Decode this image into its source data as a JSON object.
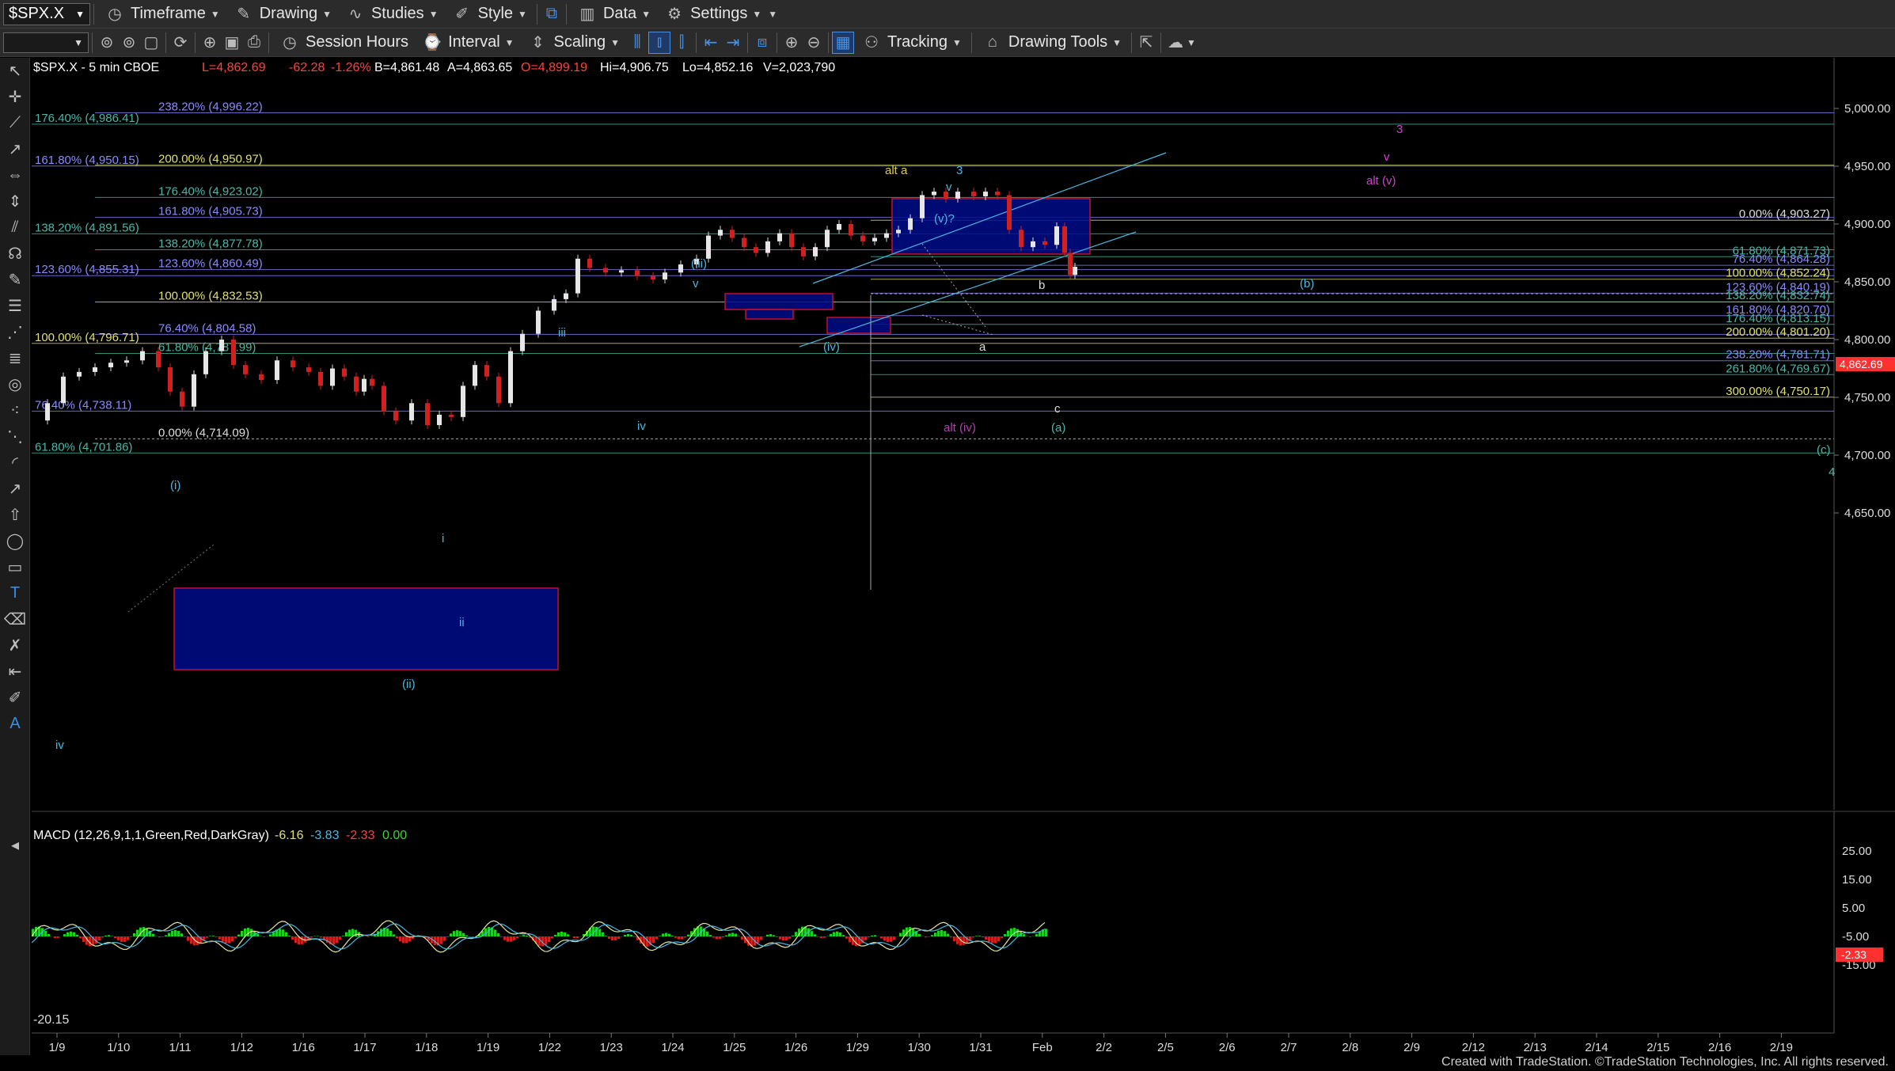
{
  "toolbar1": {
    "symbol": "$SPX.X",
    "timeframe": "Timeframe",
    "drawing": "Drawing",
    "studies": "Studies",
    "style": "Style",
    "data": "Data",
    "settings": "Settings"
  },
  "toolbar2": {
    "session_hours": "Session Hours",
    "interval": "Interval",
    "scaling": "Scaling",
    "tracking": "Tracking",
    "drawing_tools": "Drawing Tools"
  },
  "header": {
    "symbol_info": "$SPX.X - 5 min  CBOE",
    "last": "L=4,862.69",
    "net": "-62.28",
    "pct": "-1.26%",
    "bid": "B=4,861.48",
    "ask": "A=4,863.65",
    "open": "O=4,899.19",
    "hi": "Hi=4,906.75",
    "lo": "Lo=4,852.16",
    "vol": "V=2,023,790"
  },
  "price_axis": [
    "5,000.00",
    "4,950.00",
    "4,900.00",
    "4,850.00",
    "4,800.00",
    "4,750.00",
    "4,700.00",
    "4,650.00"
  ],
  "last_price_tag": "4,862.69",
  "macd": {
    "label": "MACD (12,26,9,1,1,Green,Red,DarkGray)",
    "v1": "-6.16",
    "v2": "-3.83",
    "v3": "-2.33",
    "v4": "0.00",
    "min_label": "-20.15",
    "axis": [
      "25.00",
      "15.00",
      "5.00",
      "-5.00",
      "-15.00"
    ],
    "tag": "-2.33"
  },
  "date_axis": [
    "1/9",
    "1/10",
    "1/11",
    "1/12",
    "1/16",
    "1/17",
    "1/18",
    "1/19",
    "1/22",
    "1/23",
    "1/24",
    "1/25",
    "1/26",
    "1/29",
    "1/30",
    "1/31",
    "Feb",
    "2/2",
    "2/5",
    "2/6",
    "2/7",
    "2/8",
    "2/9",
    "2/12",
    "2/13",
    "2/14",
    "2/15",
    "2/16",
    "2/19"
  ],
  "fib_left": [
    {
      "text": "238.20% (4,996.22)",
      "color": "#8a8aff"
    },
    {
      "text": "176.40% (4,986.41)",
      "color": "#49b8a8"
    },
    {
      "text": "161.80% (4,950.15)",
      "color": "#8a8aff"
    },
    {
      "text": "200.00% (4,950.97)",
      "color": "#e0e070"
    },
    {
      "text": "176.40% (4,923.02)",
      "color": "#49b8a8"
    },
    {
      "text": "161.80% (4,905.73)",
      "color": "#8a8aff"
    },
    {
      "text": "138.20% (4,891.56)",
      "color": "#49b8a8"
    },
    {
      "text": "138.20% (4,877.78)",
      "color": "#49b8a8"
    },
    {
      "text": "123.60% (4,860.49)",
      "color": "#8a8aff"
    },
    {
      "text": "123.60% (4,855.31)",
      "color": "#8a8aff"
    },
    {
      "text": "100.00% (4,832.53)",
      "color": "#e0e070"
    },
    {
      "text": "76.40% (4,804.58)",
      "color": "#8a8aff"
    },
    {
      "text": "100.00% (4,796.71)",
      "color": "#e0e070"
    },
    {
      "text": "61.80% (4,787.99)",
      "color": "#49b8a8"
    },
    {
      "text": "76.40% (4,738.11)",
      "color": "#8a8aff"
    },
    {
      "text": "0.00% (4,714.09)",
      "color": "#dddddd"
    },
    {
      "text": "61.80% (4,701.86)",
      "color": "#49b8a8"
    }
  ],
  "fib_right": [
    {
      "text": "0.00% (4,903.27)",
      "color": "#dddddd"
    },
    {
      "text": "61.80% (4,871.73)",
      "color": "#49b8a8"
    },
    {
      "text": "76.40% (4,864.28)",
      "color": "#8a8aff"
    },
    {
      "text": "100.00% (4,852.24)",
      "color": "#e0e070"
    },
    {
      "text": "123.60% (4,840.19)",
      "color": "#8a8aff"
    },
    {
      "text": "138.20% (4,832.74)",
      "color": "#49b8a8"
    },
    {
      "text": "161.80% (4,820.70)",
      "color": "#8a8aff"
    },
    {
      "text": "176.40% (4,813.15)",
      "color": "#49b8a8"
    },
    {
      "text": "200.00% (4,801.20)",
      "color": "#e0e070"
    },
    {
      "text": "238.20% (4,781.71)",
      "color": "#8a8aff"
    },
    {
      "text": "261.80% (4,769.67)",
      "color": "#49b8a8"
    },
    {
      "text": "300.00% (4,750.17)",
      "color": "#e0e070"
    }
  ],
  "wave_labels": [
    {
      "text": "alt a",
      "color": "#e0d030"
    },
    {
      "text": "3",
      "color": "#49b8e0"
    },
    {
      "text": "v",
      "color": "#49b8e0"
    },
    {
      "text": "(v)?",
      "color": "#49b8e0"
    },
    {
      "text": "(iii)",
      "color": "#49b8e0"
    },
    {
      "text": "v",
      "color": "#49b8e0"
    },
    {
      "text": "iii",
      "color": "#49b8e0"
    },
    {
      "text": "iv",
      "color": "#49b8e0"
    },
    {
      "text": "(iv)",
      "color": "#49b8e0"
    },
    {
      "text": "a",
      "color": "#dddddd"
    },
    {
      "text": "b",
      "color": "#dddddd"
    },
    {
      "text": "c",
      "color": "#dddddd"
    },
    {
      "text": "(a)",
      "color": "#49b8a8"
    },
    {
      "text": "(b)",
      "color": "#49b8e0"
    },
    {
      "text": "alt (iv)",
      "color": "#b040b0"
    },
    {
      "text": "3",
      "color": "#d040d0"
    },
    {
      "text": "v",
      "color": "#d040d0"
    },
    {
      "text": "alt (v)",
      "color": "#d040d0"
    },
    {
      "text": "(i)",
      "color": "#49b8e0"
    },
    {
      "text": "(ii)",
      "color": "#49b8e0"
    },
    {
      "text": "i",
      "color": "#49b8e0"
    },
    {
      "text": "ii",
      "color": "#49b8e0"
    },
    {
      "text": "iv",
      "color": "#49b8e0"
    },
    {
      "text": "(c)",
      "color": "#49b8a8"
    },
    {
      "text": "4",
      "color": "#49b8a8"
    }
  ],
  "footer": "Created with TradeStation. ©TradeStation Technologies, Inc. All rights reserved."
}
